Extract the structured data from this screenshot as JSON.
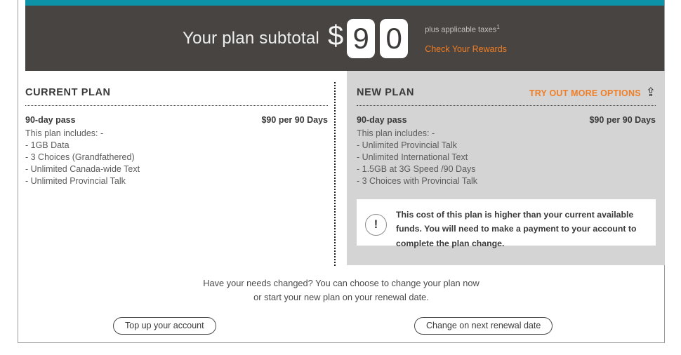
{
  "banner": {
    "subtotal_label": "Your plan subtotal",
    "currency_symbol": "$",
    "amount_digits": [
      "9",
      "0"
    ],
    "tax_note": "plus applicable taxes",
    "tax_note_superscript": "1",
    "rewards_link": "Check Your Rewards",
    "teal_color": "#0d93a8",
    "banner_color": "#484441",
    "accent_orange": "#ef7e26"
  },
  "current_plan": {
    "title": "CURRENT PLAN",
    "plan_name": "90-day pass",
    "plan_price": "$90 per 90 Days",
    "includes_label": "This plan includes: -",
    "features": [
      "- 1GB Data",
      "- 3 Choices (Grandfathered)",
      "- Unlimited Canada-wide Text",
      "- Unlimited Provincial Talk"
    ]
  },
  "new_plan": {
    "title": "NEW PLAN",
    "more_options_label": "TRY OUT MORE OPTIONS",
    "more_options_icon": "arrow-up-icon",
    "plan_name": "90-day pass",
    "plan_price": "$90 per 90 Days",
    "includes_label": "This plan includes: -",
    "features": [
      "- Unlimited Provincial Talk",
      "- Unlimited International Text",
      "- 1.5GB at 3G Speed /90 Days",
      "- 3 Choices with Provincial Talk"
    ],
    "warning": {
      "icon": "exclamation-circle-icon",
      "icon_glyph": "!",
      "text": "This cost of this plan is higher than your current available funds. You will need to make a payment to your account to complete the plan change."
    },
    "panel_color": "#d4d4d4"
  },
  "footer": {
    "line1": "Have your needs changed? You can choose to change your plan now",
    "line2": "or start your new plan on your renewal date.",
    "topup_button": "Top up your account",
    "change_button": "Change on next renewal date"
  }
}
